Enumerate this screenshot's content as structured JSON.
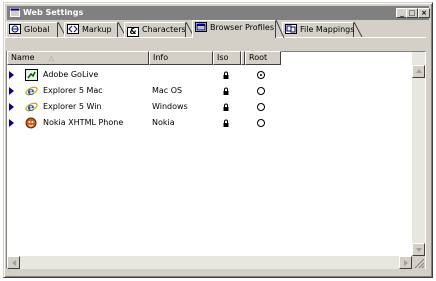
{
  "window": {
    "title": "Web Settings"
  },
  "caption_buttons": {
    "minimize": "_",
    "maximize": "□",
    "close": "×"
  },
  "tabs": [
    {
      "label": "Global",
      "icon": "globe-icon"
    },
    {
      "label": "Markup",
      "icon": "markup-icon"
    },
    {
      "label": "Characters",
      "icon": "ampersand-icon"
    },
    {
      "label": "Browser Profiles",
      "icon": "browser-icon",
      "active": true
    },
    {
      "label": "File Mappings",
      "icon": "file-mappings-icon"
    }
  ],
  "columns": {
    "name": "Name",
    "info": "Info",
    "iso": "Iso",
    "root": "Root",
    "sort_glyph": "△"
  },
  "rows": [
    {
      "name": "Adobe GoLive",
      "info": "",
      "icon": "golive-icon",
      "root_selected": true
    },
    {
      "name": "Explorer 5 Mac",
      "info": "Mac OS",
      "icon": "internet-explorer-icon",
      "root_selected": false
    },
    {
      "name": "Explorer 5 Win",
      "info": "Windows",
      "icon": "internet-explorer-icon",
      "root_selected": false
    },
    {
      "name": "Nokia XHTML Phone",
      "info": "Nokia",
      "icon": "nokia-phone-icon",
      "root_selected": false
    }
  ]
}
